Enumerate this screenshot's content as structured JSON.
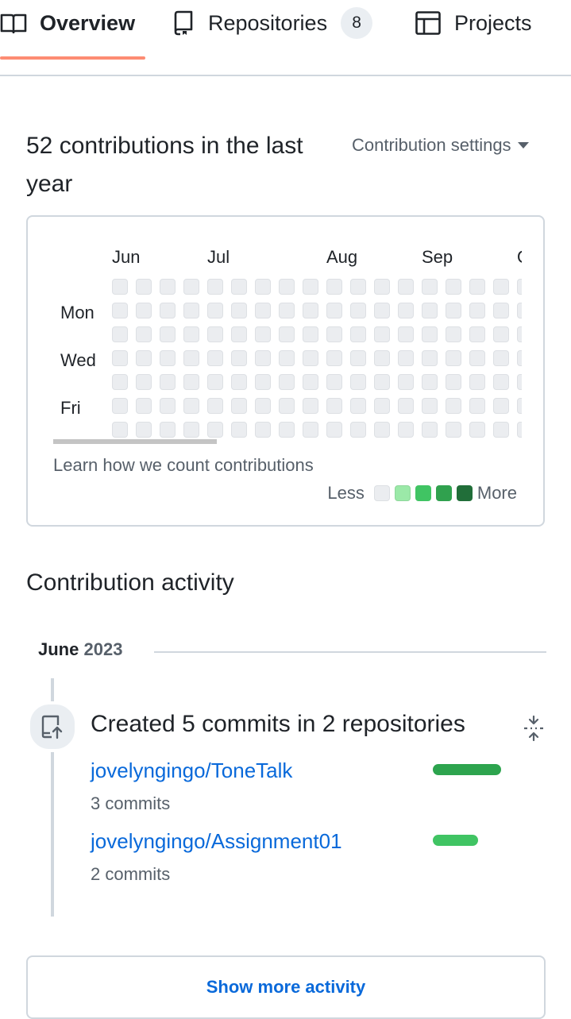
{
  "tabs": {
    "overview": "Overview",
    "repositories": "Repositories",
    "repositories_count": "8",
    "projects": "Projects"
  },
  "contributions": {
    "title": "52 contributions in the last year",
    "settings_label": "Contribution settings",
    "months": [
      "Jun",
      "Jul",
      "Aug",
      "Sep",
      "O"
    ],
    "day_labels": [
      "Mon",
      "Wed",
      "Fri"
    ],
    "learn_link": "Learn how we count contributions",
    "legend_less": "Less",
    "legend_more": "More",
    "legend_colors": [
      "#ebedf0",
      "#9be9a8",
      "#40c463",
      "#30a14e",
      "#216e39"
    ]
  },
  "activity": {
    "title": "Contribution activity",
    "month": "June",
    "year": "2023",
    "summary": "Created 5 commits in 2 repositories",
    "repos": [
      {
        "name": "jovelyngingo/ToneTalk",
        "commits": "3 commits",
        "share": 1.0,
        "color": "#2da44e"
      },
      {
        "name": "jovelyngingo/Assignment01",
        "commits": "2 commits",
        "share": 0.667,
        "color": "#40c463"
      }
    ],
    "show_more": "Show more activity"
  },
  "colors": {
    "accent_link": "#0969da",
    "tab_underline": "#fd8c73"
  }
}
